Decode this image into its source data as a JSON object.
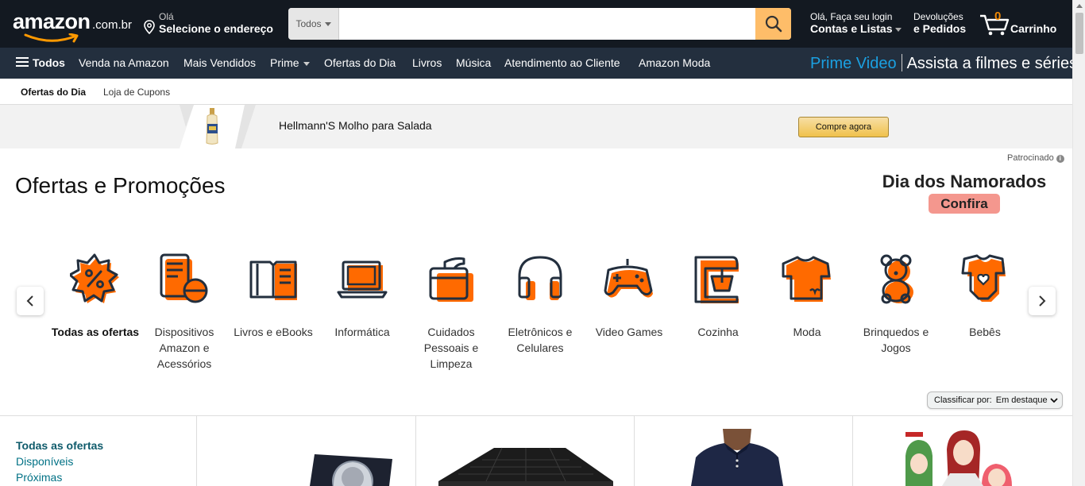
{
  "header": {
    "logo_text": "amazon",
    "logo_domain": ".com.br",
    "deliver_line1": "Olá",
    "deliver_line2": "Selecione o endereço",
    "search_dept": "Todos",
    "search_placeholder": "",
    "account_line1": "Olá, Faça seu login",
    "account_line2": "Contas e Listas",
    "returns_line1": "Devoluções",
    "returns_line2": "e Pedidos",
    "cart_count": "0",
    "cart_label": "Carrinho"
  },
  "subnav": {
    "all_label": "Todos",
    "items": [
      "Venda na Amazon",
      "Mais Vendidos",
      "Prime",
      "Ofertas do Dia",
      "Livros",
      "Música",
      "Atendimento ao Cliente",
      "Amazon Moda"
    ],
    "prime_video": "Prime Video",
    "prime_tagline": "Assista a filmes e séries"
  },
  "tabs": [
    "Ofertas do Dia",
    "Loja de Cupons"
  ],
  "banner": {
    "product_text": "Hellmann'S Molho para Salada",
    "buy_label": "Compre agora",
    "sponsored_label": "Patrocinado"
  },
  "page_title": "Ofertas e Promoções",
  "promo": {
    "title": "Dia dos Namorados",
    "cta": "Confira"
  },
  "categories": [
    {
      "label": "Todas as ofertas",
      "icon": "percent-badge-icon"
    },
    {
      "label": "Dispositivos Amazon e Acessórios",
      "icon": "kindle-device-icon"
    },
    {
      "label": "Livros e eBooks",
      "icon": "open-book-icon"
    },
    {
      "label": "Informática",
      "icon": "laptop-icon"
    },
    {
      "label": "Cuidados Pessoais e Limpeza",
      "icon": "personal-care-icon"
    },
    {
      "label": "Eletrônicos e Celulares",
      "icon": "headphones-icon"
    },
    {
      "label": "Video Games",
      "icon": "gamepad-icon"
    },
    {
      "label": "Cozinha",
      "icon": "stand-mixer-icon"
    },
    {
      "label": "Moda",
      "icon": "tshirt-icon"
    },
    {
      "label": "Brinquedos e Jogos",
      "icon": "teddy-bear-icon"
    },
    {
      "label": "Bebês",
      "icon": "baby-bodysuit-icon"
    }
  ],
  "sort": {
    "label": "Classificar por:",
    "value": "Em destaque"
  },
  "filters": [
    "Todas as ofertas",
    "Disponíveis",
    "Próximas"
  ],
  "colors": {
    "nav_dark": "#131921",
    "nav_secondary": "#232f3e",
    "accent_orange": "#ff6a00",
    "search_button": "#febd69",
    "link_teal": "#007185",
    "prime_blue": "#1ba0e1",
    "promo_pink": "#f4978e"
  }
}
